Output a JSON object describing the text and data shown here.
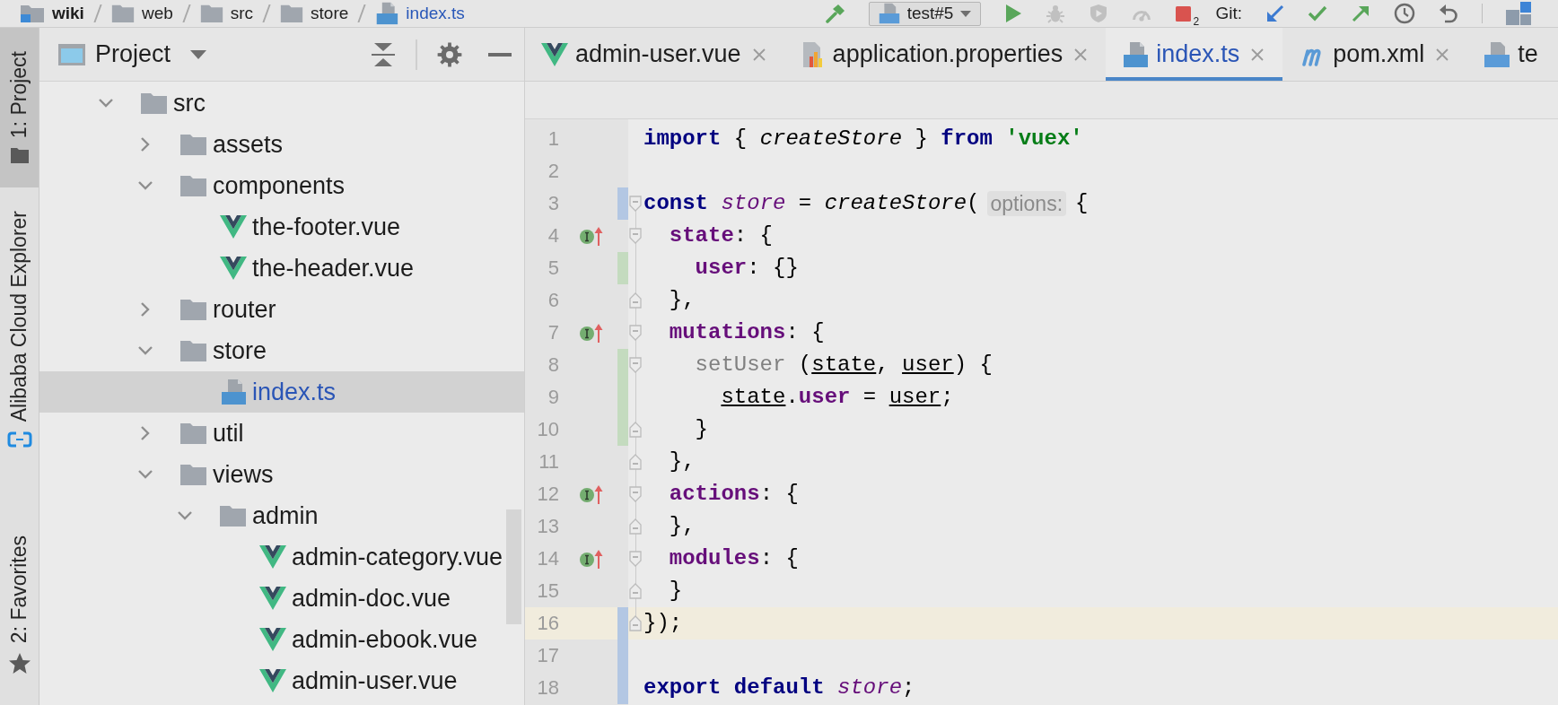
{
  "navigation_bar": {
    "breadcrumbs": [
      {
        "label": "wiki",
        "kind": "project",
        "modified": false
      },
      {
        "label": "web",
        "kind": "folder",
        "modified": false
      },
      {
        "label": "src",
        "kind": "folder",
        "modified": false
      },
      {
        "label": "store",
        "kind": "folder",
        "modified": false
      },
      {
        "label": "index.ts",
        "kind": "ts",
        "modified": true
      }
    ],
    "build": {
      "disabled": false
    },
    "run_config": {
      "label": "test#5"
    },
    "run_actions": [
      {
        "kind": "run",
        "disabled": false
      },
      {
        "kind": "debug",
        "disabled": true
      },
      {
        "kind": "coverage",
        "disabled": true
      },
      {
        "kind": "profile",
        "disabled": true
      },
      {
        "kind": "stop",
        "disabled": false,
        "count": "2"
      }
    ],
    "vcs": {
      "label": "Git:",
      "actions": [
        {
          "kind": "update",
          "disabled": false
        },
        {
          "kind": "commit",
          "disabled": false
        },
        {
          "kind": "push",
          "disabled": false
        },
        {
          "kind": "history",
          "disabled": false
        },
        {
          "kind": "rollback",
          "disabled": false
        }
      ]
    }
  },
  "tool_window_bar": {
    "top": [
      {
        "label": "1: Project",
        "kind": "project",
        "selected": true
      },
      {
        "label": "Alibaba Cloud Explorer",
        "kind": "cloud",
        "selected": false
      }
    ],
    "bottom": [
      {
        "label": "2: Favorites",
        "kind": "favorites",
        "selected": false
      }
    ]
  },
  "project_panel": {
    "title": "Project",
    "tree": [
      {
        "label": "src",
        "kind": "folder",
        "expanded": true,
        "selected": false,
        "modified": false,
        "children": [
          {
            "label": "assets",
            "kind": "folder",
            "expanded": false,
            "selected": false,
            "modified": false
          },
          {
            "label": "components",
            "kind": "folder",
            "expanded": true,
            "selected": false,
            "modified": false,
            "children": [
              {
                "label": "the-footer.vue",
                "kind": "vue",
                "selected": false,
                "modified": false
              },
              {
                "label": "the-header.vue",
                "kind": "vue",
                "selected": false,
                "modified": false
              }
            ]
          },
          {
            "label": "router",
            "kind": "folder",
            "expanded": false,
            "selected": false,
            "modified": false
          },
          {
            "label": "store",
            "kind": "folder",
            "expanded": true,
            "selected": false,
            "modified": false,
            "children": [
              {
                "label": "index.ts",
                "kind": "ts",
                "selected": true,
                "modified": true
              }
            ]
          },
          {
            "label": "util",
            "kind": "folder",
            "expanded": false,
            "selected": false,
            "modified": false
          },
          {
            "label": "views",
            "kind": "folder",
            "expanded": true,
            "selected": false,
            "modified": false,
            "children": [
              {
                "label": "admin",
                "kind": "folder",
                "expanded": true,
                "selected": false,
                "modified": false,
                "children": [
                  {
                    "label": "admin-category.vue",
                    "kind": "vue",
                    "selected": false,
                    "modified": false
                  },
                  {
                    "label": "admin-doc.vue",
                    "kind": "vue",
                    "selected": false,
                    "modified": false
                  },
                  {
                    "label": "admin-ebook.vue",
                    "kind": "vue",
                    "selected": false,
                    "modified": false
                  },
                  {
                    "label": "admin-user.vue",
                    "kind": "vue",
                    "selected": false,
                    "modified": false
                  }
                ]
              }
            ]
          }
        ]
      }
    ]
  },
  "editor": {
    "tabs": [
      {
        "label": "admin-user.vue",
        "kind": "vue",
        "selected": false,
        "modified": false
      },
      {
        "label": "application.properties",
        "kind": "properties",
        "selected": false,
        "modified": false
      },
      {
        "label": "index.ts",
        "kind": "ts",
        "selected": true,
        "modified": true
      },
      {
        "label": "pom.xml",
        "kind": "maven",
        "selected": false,
        "modified": false
      },
      {
        "label": "te",
        "kind": "api",
        "selected": false,
        "modified": false
      }
    ],
    "lines": [
      {
        "number": "1",
        "implemented": false,
        "current": false,
        "added": false,
        "modified": false,
        "fold_start": false,
        "fold_end": false,
        "tokens": [
          {
            "text": "import",
            "kind": "keyword"
          },
          {
            "text": " { ",
            "kind": "plain"
          },
          {
            "text": "createStore",
            "kind": "function"
          },
          {
            "text": " } ",
            "kind": "plain"
          },
          {
            "text": "from ",
            "kind": "keyword"
          },
          {
            "text": "'vuex'",
            "kind": "string"
          }
        ]
      },
      {
        "number": "2",
        "implemented": false,
        "current": false,
        "added": false,
        "modified": false,
        "fold_start": false,
        "fold_end": false
      },
      {
        "number": "3",
        "implemented": false,
        "current": false,
        "added": false,
        "modified": true,
        "fold_start": true,
        "fold_end": false,
        "tokens": [
          {
            "text": "const ",
            "kind": "keyword"
          },
          {
            "text": "store",
            "kind": "variable"
          },
          {
            "text": " = ",
            "kind": "plain"
          },
          {
            "text": "createStore",
            "kind": "function"
          },
          {
            "text": "(",
            "kind": "plain"
          },
          {
            "text": "options:",
            "kind": "hint"
          },
          {
            "text": "{",
            "kind": "plain"
          }
        ],
        "children": [
          {
            "number": "4",
            "implemented": true,
            "current": false,
            "added": false,
            "modified": false,
            "fold_start": true,
            "fold_end": false,
            "tokens": [
              {
                "text": "state",
                "kind": "field"
              },
              {
                "text": ": {",
                "kind": "plain"
              }
            ],
            "children": [
              {
                "number": "5",
                "implemented": false,
                "current": false,
                "added": true,
                "modified": false,
                "fold_start": false,
                "fold_end": false,
                "tokens": [
                  {
                    "text": "user",
                    "kind": "field"
                  },
                  {
                    "text": ": {}",
                    "kind": "plain"
                  }
                ]
              }
            ]
          },
          {
            "number": "6",
            "implemented": false,
            "current": false,
            "added": false,
            "modified": false,
            "fold_start": false,
            "fold_end": true,
            "tokens": [
              {
                "text": "},",
                "kind": "plain"
              }
            ]
          },
          {
            "number": "7",
            "implemented": true,
            "current": false,
            "added": false,
            "modified": false,
            "fold_start": true,
            "fold_end": false,
            "tokens": [
              {
                "text": "mutations",
                "kind": "field"
              },
              {
                "text": ": {",
                "kind": "plain"
              }
            ],
            "children": [
              {
                "number": "8",
                "implemented": false,
                "current": false,
                "added": true,
                "modified": false,
                "fold_start": true,
                "fold_end": false,
                "tokens": [
                  {
                    "text": "setUser",
                    "kind": "unused"
                  },
                  {
                    "text": " (",
                    "kind": "plain"
                  },
                  {
                    "text": "state",
                    "kind": "param"
                  },
                  {
                    "text": ", ",
                    "kind": "plain"
                  },
                  {
                    "text": "user",
                    "kind": "param"
                  },
                  {
                    "text": ") {",
                    "kind": "plain"
                  }
                ],
                "children": [
                  {
                    "number": "9",
                    "implemented": false,
                    "current": false,
                    "added": true,
                    "modified": false,
                    "fold_start": false,
                    "fold_end": false,
                    "tokens": [
                      {
                        "text": "state",
                        "kind": "param"
                      },
                      {
                        "text": ".",
                        "kind": "plain"
                      },
                      {
                        "text": "user",
                        "kind": "field"
                      },
                      {
                        "text": " = ",
                        "kind": "plain"
                      },
                      {
                        "text": "user",
                        "kind": "param"
                      },
                      {
                        "text": ";",
                        "kind": "plain"
                      }
                    ]
                  }
                ]
              },
              {
                "number": "10",
                "implemented": false,
                "current": false,
                "added": true,
                "modified": false,
                "fold_start": false,
                "fold_end": true,
                "tokens": [
                  {
                    "text": "}",
                    "kind": "plain"
                  }
                ]
              }
            ]
          },
          {
            "number": "11",
            "implemented": false,
            "current": false,
            "added": false,
            "modified": false,
            "fold_start": false,
            "fold_end": true,
            "tokens": [
              {
                "text": "},",
                "kind": "plain"
              }
            ]
          },
          {
            "number": "12",
            "implemented": true,
            "current": false,
            "added": false,
            "modified": false,
            "fold_start": true,
            "fold_end": false,
            "tokens": [
              {
                "text": "actions",
                "kind": "field"
              },
              {
                "text": ": {",
                "kind": "plain"
              }
            ]
          },
          {
            "number": "13",
            "implemented": false,
            "current": false,
            "added": false,
            "modified": false,
            "fold_start": false,
            "fold_end": true,
            "tokens": [
              {
                "text": "},",
                "kind": "plain"
              }
            ]
          },
          {
            "number": "14",
            "implemented": true,
            "current": false,
            "added": false,
            "modified": false,
            "fold_start": true,
            "fold_end": false,
            "tokens": [
              {
                "text": "modules",
                "kind": "field"
              },
              {
                "text": ": {",
                "kind": "plain"
              }
            ]
          },
          {
            "number": "15",
            "implemented": false,
            "current": false,
            "added": false,
            "modified": false,
            "fold_start": false,
            "fold_end": true,
            "tokens": [
              {
                "text": "}",
                "kind": "plain"
              }
            ]
          }
        ]
      },
      {
        "number": "16",
        "implemented": false,
        "current": true,
        "added": false,
        "modified": true,
        "fold_start": false,
        "fold_end": true,
        "tokens": [
          {
            "text": "});",
            "kind": "plain"
          }
        ]
      },
      {
        "number": "17",
        "implemented": false,
        "current": false,
        "added": false,
        "modified": true,
        "fold_start": false,
        "fold_end": false
      },
      {
        "number": "18",
        "implemented": false,
        "current": false,
        "added": false,
        "modified": true,
        "fold_start": false,
        "fold_end": false,
        "tokens": [
          {
            "text": "export ",
            "kind": "keyword"
          },
          {
            "text": "default ",
            "kind": "keyword"
          },
          {
            "text": "store",
            "kind": "variable"
          },
          {
            "text": ";",
            "kind": "plain"
          }
        ]
      }
    ]
  }
}
